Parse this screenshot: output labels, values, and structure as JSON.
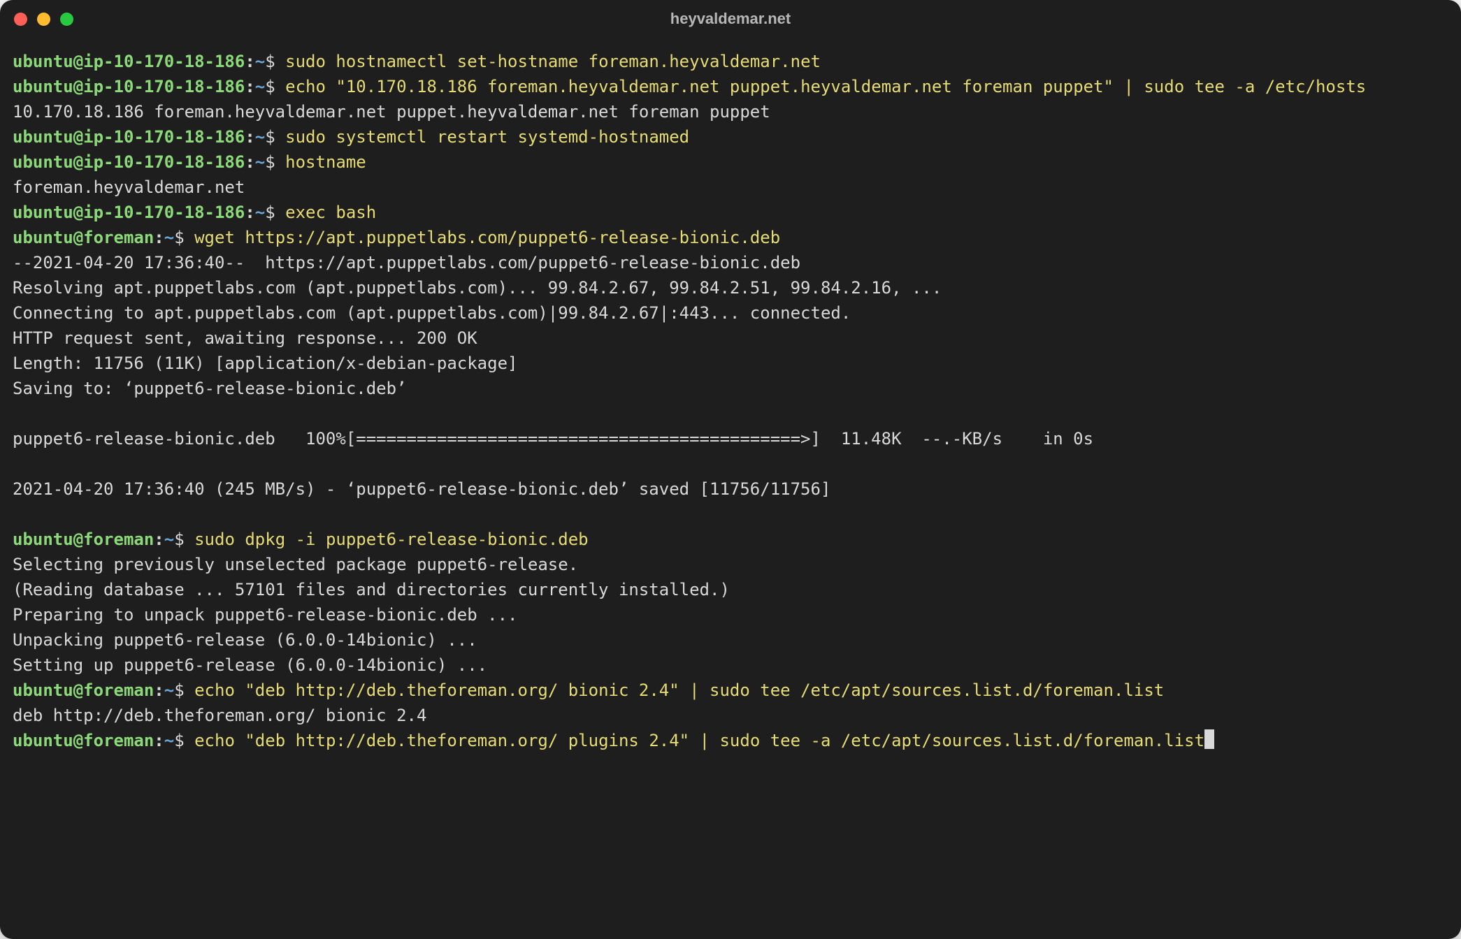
{
  "window": {
    "title": "heyvaldemar.net"
  },
  "prompts": {
    "p1_user": "ubuntu@ip-10-170-18-186",
    "p1_path": "~",
    "p2_user": "ubuntu@foreman",
    "p2_path": "~"
  },
  "lines": {
    "c1": "sudo hostnamectl set-hostname foreman.heyvaldemar.net",
    "c2": "echo \"10.170.18.186 foreman.heyvaldemar.net puppet.heyvaldemar.net foreman puppet\" | sudo tee -a /etc/hosts",
    "o2": "10.170.18.186 foreman.heyvaldemar.net puppet.heyvaldemar.net foreman puppet",
    "c3": "sudo systemctl restart systemd-hostnamed",
    "c4": "hostname",
    "o4": "foreman.heyvaldemar.net",
    "c5": "exec bash",
    "c6": "wget https://apt.puppetlabs.com/puppet6-release-bionic.deb",
    "o6a": "--2021-04-20 17:36:40--  https://apt.puppetlabs.com/puppet6-release-bionic.deb",
    "o6b": "Resolving apt.puppetlabs.com (apt.puppetlabs.com)... 99.84.2.67, 99.84.2.51, 99.84.2.16, ...",
    "o6c": "Connecting to apt.puppetlabs.com (apt.puppetlabs.com)|99.84.2.67|:443... connected.",
    "o6d": "HTTP request sent, awaiting response... 200 OK",
    "o6e": "Length: 11756 (11K) [application/x-debian-package]",
    "o6f": "Saving to: ‘puppet6-release-bionic.deb’",
    "o6g": "puppet6-release-bionic.deb   100%[============================================>]  11.48K  --.-KB/s    in 0s",
    "o6h": "2021-04-20 17:36:40 (245 MB/s) - ‘puppet6-release-bionic.deb’ saved [11756/11756]",
    "c7": "sudo dpkg -i puppet6-release-bionic.deb",
    "o7a": "Selecting previously unselected package puppet6-release.",
    "o7b": "(Reading database ... 57101 files and directories currently installed.)",
    "o7c": "Preparing to unpack puppet6-release-bionic.deb ...",
    "o7d": "Unpacking puppet6-release (6.0.0-14bionic) ...",
    "o7e": "Setting up puppet6-release (6.0.0-14bionic) ...",
    "c8": "echo \"deb http://deb.theforeman.org/ bionic 2.4\" | sudo tee /etc/apt/sources.list.d/foreman.list",
    "o8": "deb http://deb.theforeman.org/ bionic 2.4",
    "c9": "echo \"deb http://deb.theforeman.org/ plugins 2.4\" | sudo tee -a /etc/apt/sources.list.d/foreman.list"
  }
}
